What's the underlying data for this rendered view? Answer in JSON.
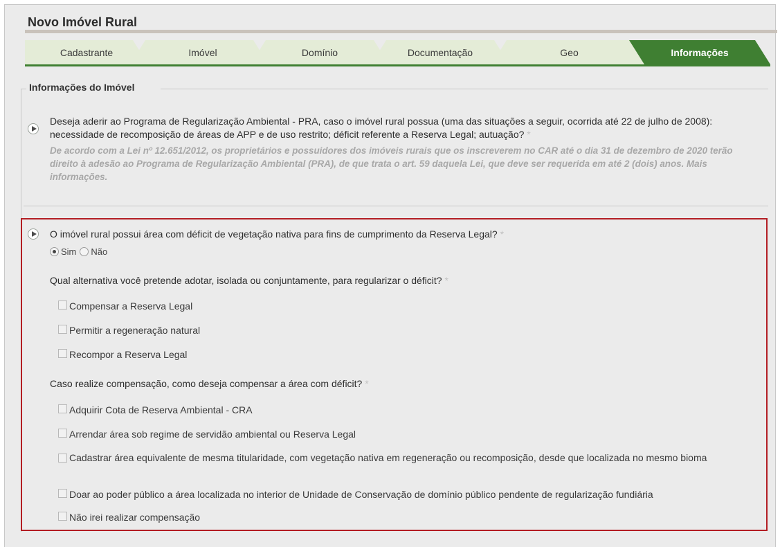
{
  "page": {
    "title": "Novo Imóvel Rural"
  },
  "tabs": [
    {
      "label": "Cadastrante"
    },
    {
      "label": "Imóvel"
    },
    {
      "label": "Domínio"
    },
    {
      "label": "Documentação"
    },
    {
      "label": "Geo"
    },
    {
      "label": "Informações",
      "active": true
    }
  ],
  "section": {
    "legend": "Informações do Imóvel"
  },
  "q1": {
    "text": "Deseja aderir ao Programa de Regularização Ambiental - PRA, caso o imóvel rural possua (uma das situações a seguir, ocorrida até 22 de julho de 2008): necessidade de recomposição de áreas de APP e de uso restrito; déficit referente a Reserva Legal; autuação?",
    "required": "*",
    "hint": "De acordo com a Lei nº 12.651/2012, os proprietários e possuidores dos imóveis rurais que os inscreverem no CAR até o dia 31 de dezembro de 2020 terão direito à adesão ao Programa de Regularização Ambiental (PRA), de que trata o art. 59 daquela Lei, que deve ser requerida em até 2 (dois) anos. Mais informações."
  },
  "q2": {
    "text": "O imóvel rural possui área com déficit de vegetação nativa para fins de cumprimento da Reserva Legal?",
    "required": "*",
    "options": {
      "yes": "Sim",
      "no": "Não",
      "selected": "Sim"
    }
  },
  "q3": {
    "text": "Qual alternativa você pretende adotar, isolada ou conjuntamente, para regularizar o déficit?",
    "required": "*",
    "options": [
      "Compensar a Reserva Legal",
      "Permitir a regeneração natural",
      "Recompor a Reserva Legal"
    ]
  },
  "q4": {
    "text": "Caso realize compensação, como deseja compensar a área com déficit?",
    "required": "*",
    "options": [
      "Adquirir Cota de Reserva Ambiental - CRA",
      "Arrendar área sob regime de servidão ambiental ou Reserva Legal",
      "Cadastrar área equivalente de mesma titularidade, com vegetação nativa em regeneração ou recomposição, desde que localizada no mesmo bioma",
      "Doar ao poder público a área localizada no interior de Unidade de Conservação de domínio público pendente de regularização fundiária",
      "Não irei realizar compensação"
    ]
  },
  "colors": {
    "accent": "#3f7f32",
    "tab_bg": "#e4ecd7",
    "highlight_border": "#b31d23"
  }
}
